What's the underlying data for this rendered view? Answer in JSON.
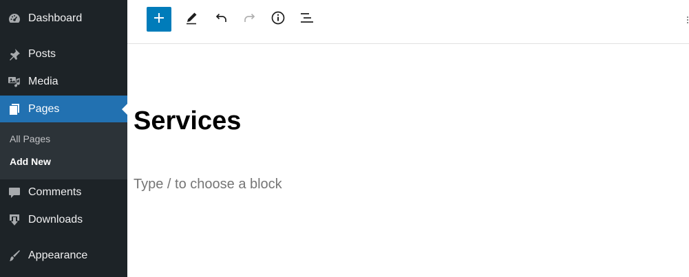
{
  "sidebar": {
    "items": [
      {
        "label": "Dashboard",
        "icon": "dashboard-icon"
      },
      {
        "label": "Posts",
        "icon": "pin-icon"
      },
      {
        "label": "Media",
        "icon": "media-icon"
      },
      {
        "label": "Pages",
        "icon": "pages-icon",
        "active": true
      },
      {
        "label": "Comments",
        "icon": "comment-icon"
      },
      {
        "label": "Downloads",
        "icon": "download-icon"
      },
      {
        "label": "Appearance",
        "icon": "paintbrush-icon"
      }
    ],
    "submenu": [
      {
        "label": "All Pages"
      },
      {
        "label": "Add New",
        "current": true
      }
    ],
    "colors": {
      "background": "#1d2327",
      "active": "#2271b1",
      "submenu_background": "#2c3338"
    }
  },
  "toolbar": {
    "buttons": [
      "add-block-button",
      "edit-tool-button",
      "undo-button",
      "redo-button",
      "details-button",
      "list-view-button"
    ],
    "inserter_color": "#007cba"
  },
  "editor": {
    "title": "Services",
    "block_placeholder": "Type / to choose a block"
  }
}
